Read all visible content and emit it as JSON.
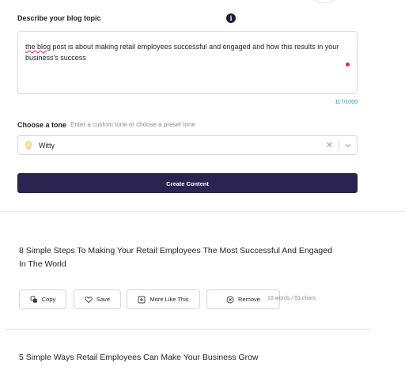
{
  "form": {
    "topic_label": "Describe your blog topic",
    "info_icon_glyph": "i",
    "topic_text_prefix": "the blog",
    "topic_text_rest": " post is about making retail employees successful and engaged and how this results in your business's success",
    "char_count": "117/1000",
    "tone_label": "Choose a tone",
    "tone_hint": "Enter a custom tone or choose a preset tone",
    "tone_value": "Witty",
    "clear_glyph": "✕",
    "create_label": "Create Content"
  },
  "results": [
    {
      "title": "8 Simple Steps To Making Your Retail Employees The Most Successful And Engaged In The World",
      "actions": {
        "copy": "Copy",
        "save": "Save",
        "more": "More Like This",
        "remove": "Remove"
      },
      "stats": "16 words / 91 chars"
    },
    {
      "title": "5 Simple Ways Retail Employees Can Make Your Business Grow"
    }
  ],
  "colors": {
    "accent": "#2b2350",
    "count_teal": "#2b8fa5",
    "dot_red": "#e0244a"
  }
}
